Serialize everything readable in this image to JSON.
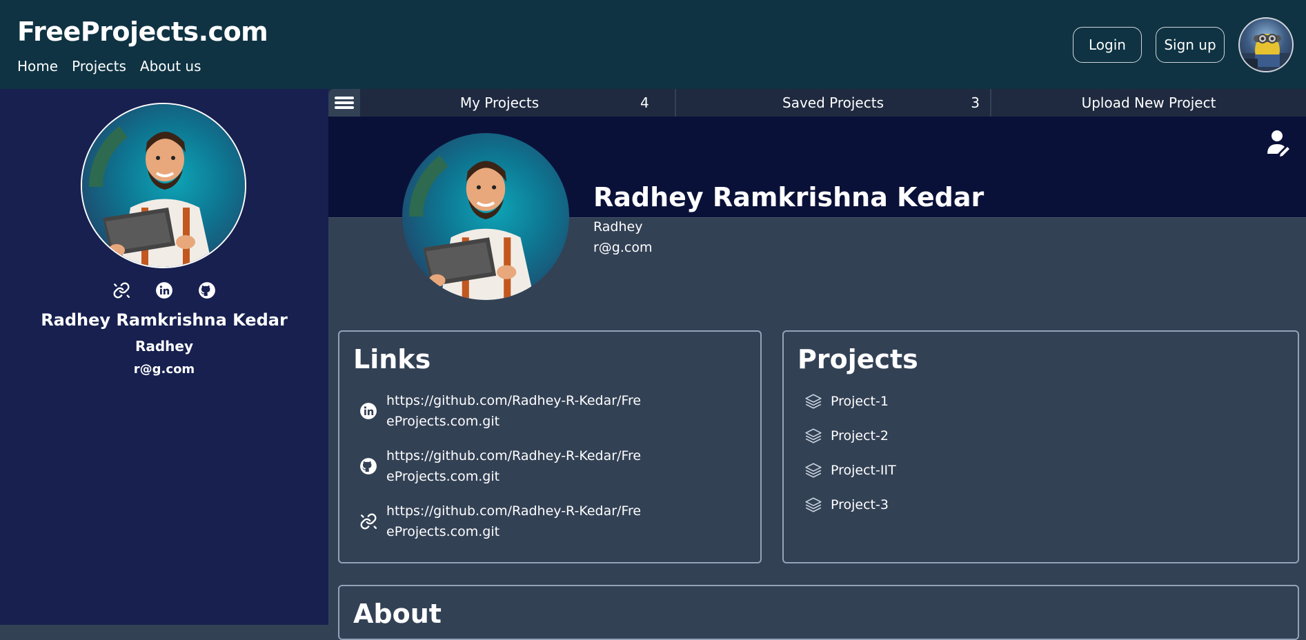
{
  "header": {
    "brand": "FreeProjects.com",
    "nav": [
      "Home",
      "Projects",
      "About us"
    ],
    "login_label": "Login",
    "signup_label": "Sign up"
  },
  "sidebar": {
    "name": "Radhey Ramkrishna Kedar",
    "username": "Radhey",
    "email": "r@g.com",
    "icons": [
      "link-icon",
      "linkedin-icon",
      "github-icon"
    ]
  },
  "tabs": [
    {
      "label": "My Projects",
      "count": "4"
    },
    {
      "label": "Saved Projects",
      "count": "3"
    },
    {
      "label": "Upload New Project",
      "count": ""
    }
  ],
  "profile": {
    "name": "Radhey Ramkrishna Kedar",
    "username": "Radhey",
    "email": "r@g.com"
  },
  "links": {
    "title": "Links",
    "items": [
      {
        "icon": "linkedin-icon",
        "url": "https://github.com/Radhey-R-Kedar/FreeProjects.com.git"
      },
      {
        "icon": "github-icon",
        "url": "https://github.com/Radhey-R-Kedar/FreeProjects.com.git"
      },
      {
        "icon": "link-icon",
        "url": "https://github.com/Radhey-R-Kedar/FreeProjects.com.git"
      }
    ]
  },
  "projects": {
    "title": "Projects",
    "items": [
      "Project-1",
      "Project-2",
      "Project-IIT",
      "Project-3"
    ]
  },
  "about": {
    "title": "About"
  },
  "colors": {
    "header_bg": "#0f3343",
    "sidebar_bg": "#17204f",
    "banner_bg": "#0a1138",
    "main_bg": "#334155",
    "tabbar_bg": "#1f2a40"
  }
}
